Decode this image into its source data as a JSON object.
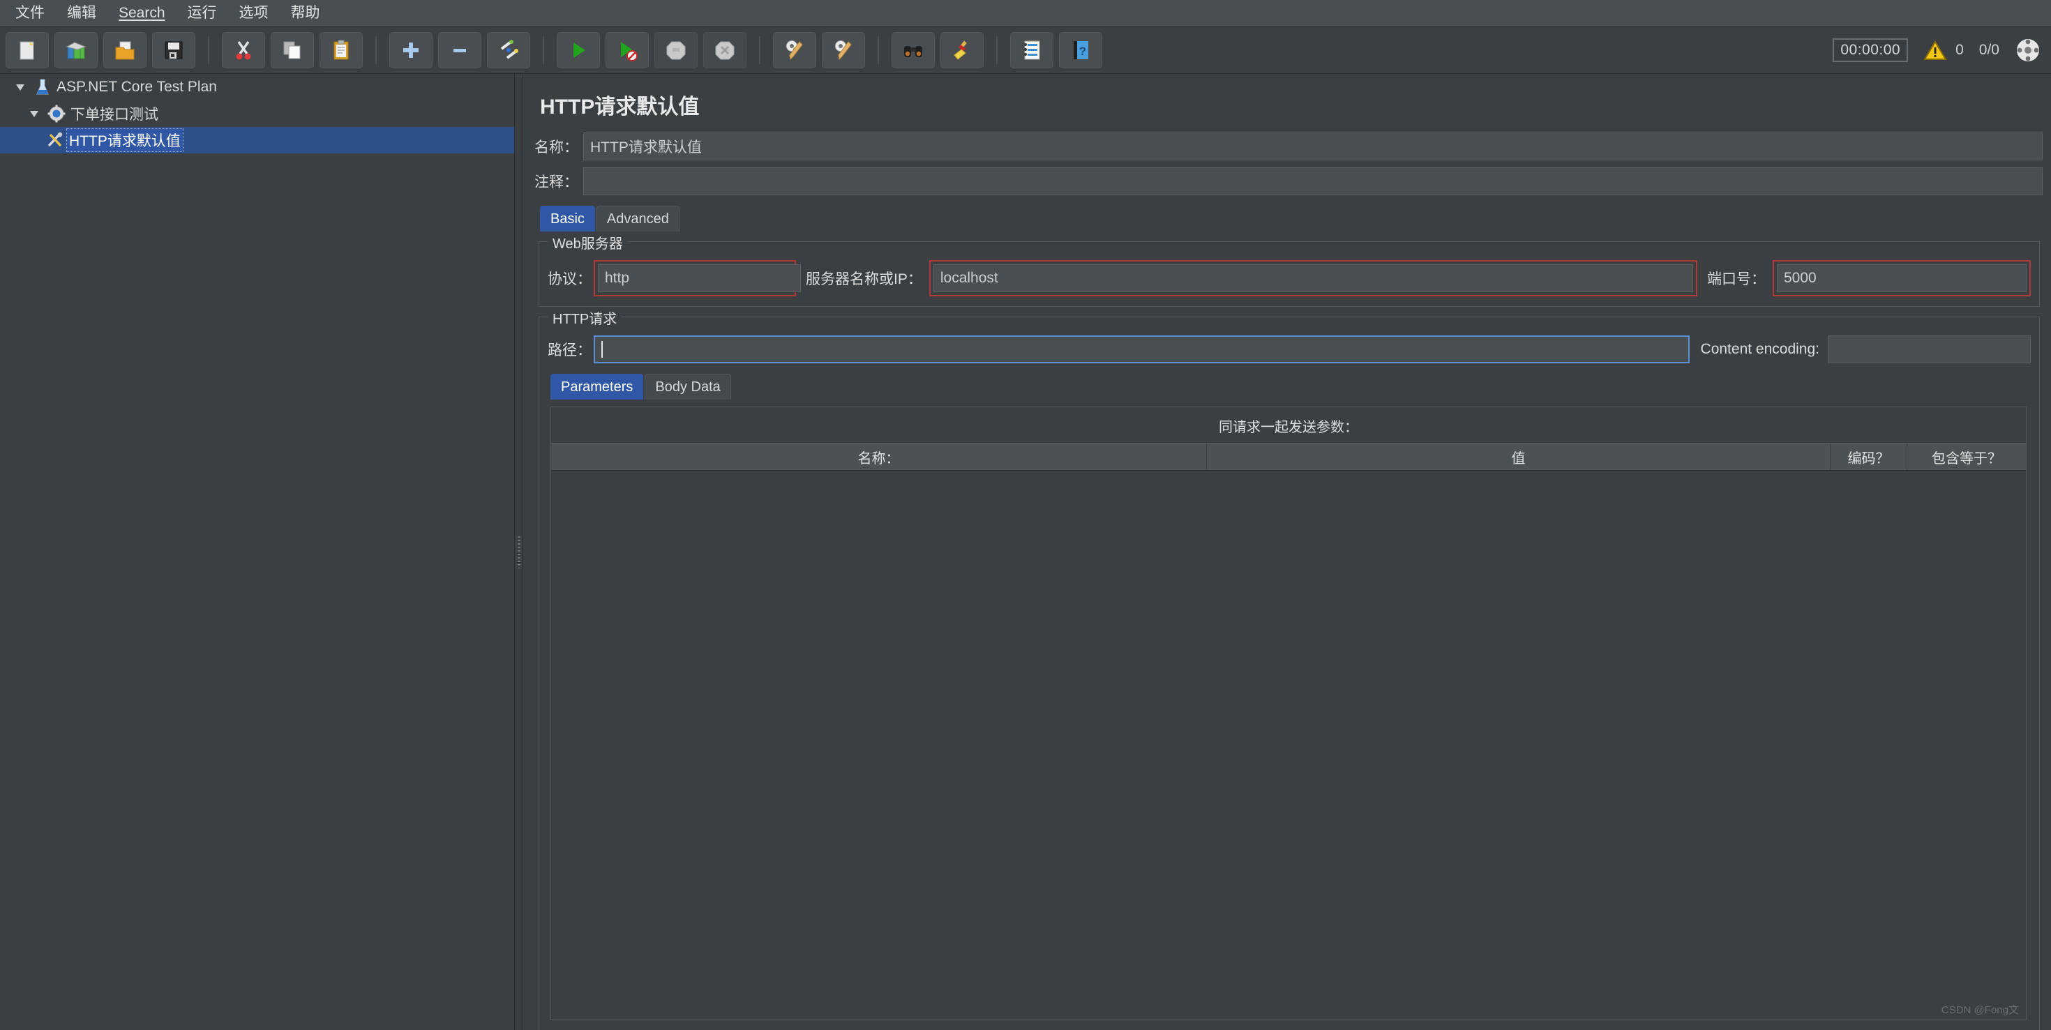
{
  "menubar": {
    "items": [
      {
        "label": "文件",
        "mnemonic": false
      },
      {
        "label": "编辑",
        "mnemonic": false
      },
      {
        "label": "Search",
        "mnemonic": true
      },
      {
        "label": "运行",
        "mnemonic": false
      },
      {
        "label": "选项",
        "mnemonic": false
      },
      {
        "label": "帮助",
        "mnemonic": false
      }
    ]
  },
  "toolbar": {
    "buttons": [
      {
        "name": "new-test-plan-button",
        "icon": "new-document-icon",
        "tooltip": "New"
      },
      {
        "name": "templates-button",
        "icon": "templates-books-icon",
        "tooltip": "Templates"
      },
      {
        "name": "open-button",
        "icon": "open-folder-icon",
        "tooltip": "Open"
      },
      {
        "name": "save-button",
        "icon": "floppy-save-icon",
        "tooltip": "Save"
      },
      {
        "name": "cut-button",
        "icon": "scissors-cut-icon",
        "tooltip": "Cut"
      },
      {
        "name": "copy-button",
        "icon": "copy-pages-icon",
        "tooltip": "Copy"
      },
      {
        "name": "paste-button",
        "icon": "clipboard-paste-icon",
        "tooltip": "Paste"
      },
      {
        "name": "expand-all-button",
        "icon": "plus-icon",
        "tooltip": "Expand all"
      },
      {
        "name": "collapse-all-button",
        "icon": "minus-icon",
        "tooltip": "Collapse all"
      },
      {
        "name": "toggle-button",
        "icon": "toggle-pencils-icon",
        "tooltip": "Toggle"
      },
      {
        "name": "start-button",
        "icon": "green-play-icon",
        "tooltip": "Start"
      },
      {
        "name": "start-no-pauses-button",
        "icon": "green-play-no-timers-icon",
        "tooltip": "Start no pauses"
      },
      {
        "name": "stop-button",
        "icon": "stop-octagon-icon",
        "tooltip": "Stop"
      },
      {
        "name": "shutdown-button",
        "icon": "shutdown-octagon-icon",
        "tooltip": "Shutdown"
      },
      {
        "name": "clear-button",
        "icon": "gear-broom-icon",
        "tooltip": "Clear"
      },
      {
        "name": "clear-all-button",
        "icon": "gear-broom-all-icon",
        "tooltip": "Clear all"
      },
      {
        "name": "search-button",
        "icon": "binoculars-icon",
        "tooltip": "Search"
      },
      {
        "name": "reset-search-button",
        "icon": "yellow-broom-icon",
        "tooltip": "Reset search"
      },
      {
        "name": "function-helper-button",
        "icon": "notepad-list-icon",
        "tooltip": "Function helper"
      },
      {
        "name": "help-button",
        "icon": "help-book-icon",
        "tooltip": "Help"
      }
    ],
    "status": {
      "timer": "00:00:00",
      "warning_count": "0",
      "threads": "0/0"
    }
  },
  "tree": {
    "nodes": [
      {
        "label": "ASP.NET Core Test Plan",
        "icon": "flask-icon",
        "expanded": true,
        "level": 0,
        "selected": false
      },
      {
        "label": "下单接口测试",
        "icon": "gear-thread-group-icon",
        "expanded": true,
        "level": 1,
        "selected": false
      },
      {
        "label": "HTTP请求默认值",
        "icon": "wrench-config-icon",
        "expanded": false,
        "level": 2,
        "selected": true
      }
    ]
  },
  "main": {
    "title": "HTTP请求默认值",
    "name_label": "名称：",
    "name_value": "HTTP请求默认值",
    "comment_label": "注释：",
    "comment_value": "",
    "tabs": [
      {
        "label": "Basic",
        "active": true
      },
      {
        "label": "Advanced",
        "active": false
      }
    ],
    "web_server": {
      "group_title": "Web服务器",
      "protocol_label": "协议：",
      "protocol_value": "http",
      "server_label": "服务器名称或IP：",
      "server_value": "localhost",
      "port_label": "端口号：",
      "port_value": "5000"
    },
    "http_request": {
      "group_title": "HTTP请求",
      "path_label": "路径：",
      "path_value": "",
      "content_encoding_label": "Content encoding:",
      "content_encoding_value": "",
      "sub_tabs": [
        {
          "label": "Parameters",
          "active": true
        },
        {
          "label": "Body Data",
          "active": false
        }
      ],
      "params_caption": "同请求一起发送参数：",
      "table_headers": [
        "名称：",
        "值",
        "编码？",
        "包含等于？"
      ],
      "rows": []
    }
  },
  "watermark": "CSDN @Fong文",
  "colors": {
    "background": "#3c3f41",
    "accent_selected": "#2f57a6",
    "highlight_box": "#b03a3a",
    "focus_border": "#5b8fd4"
  }
}
